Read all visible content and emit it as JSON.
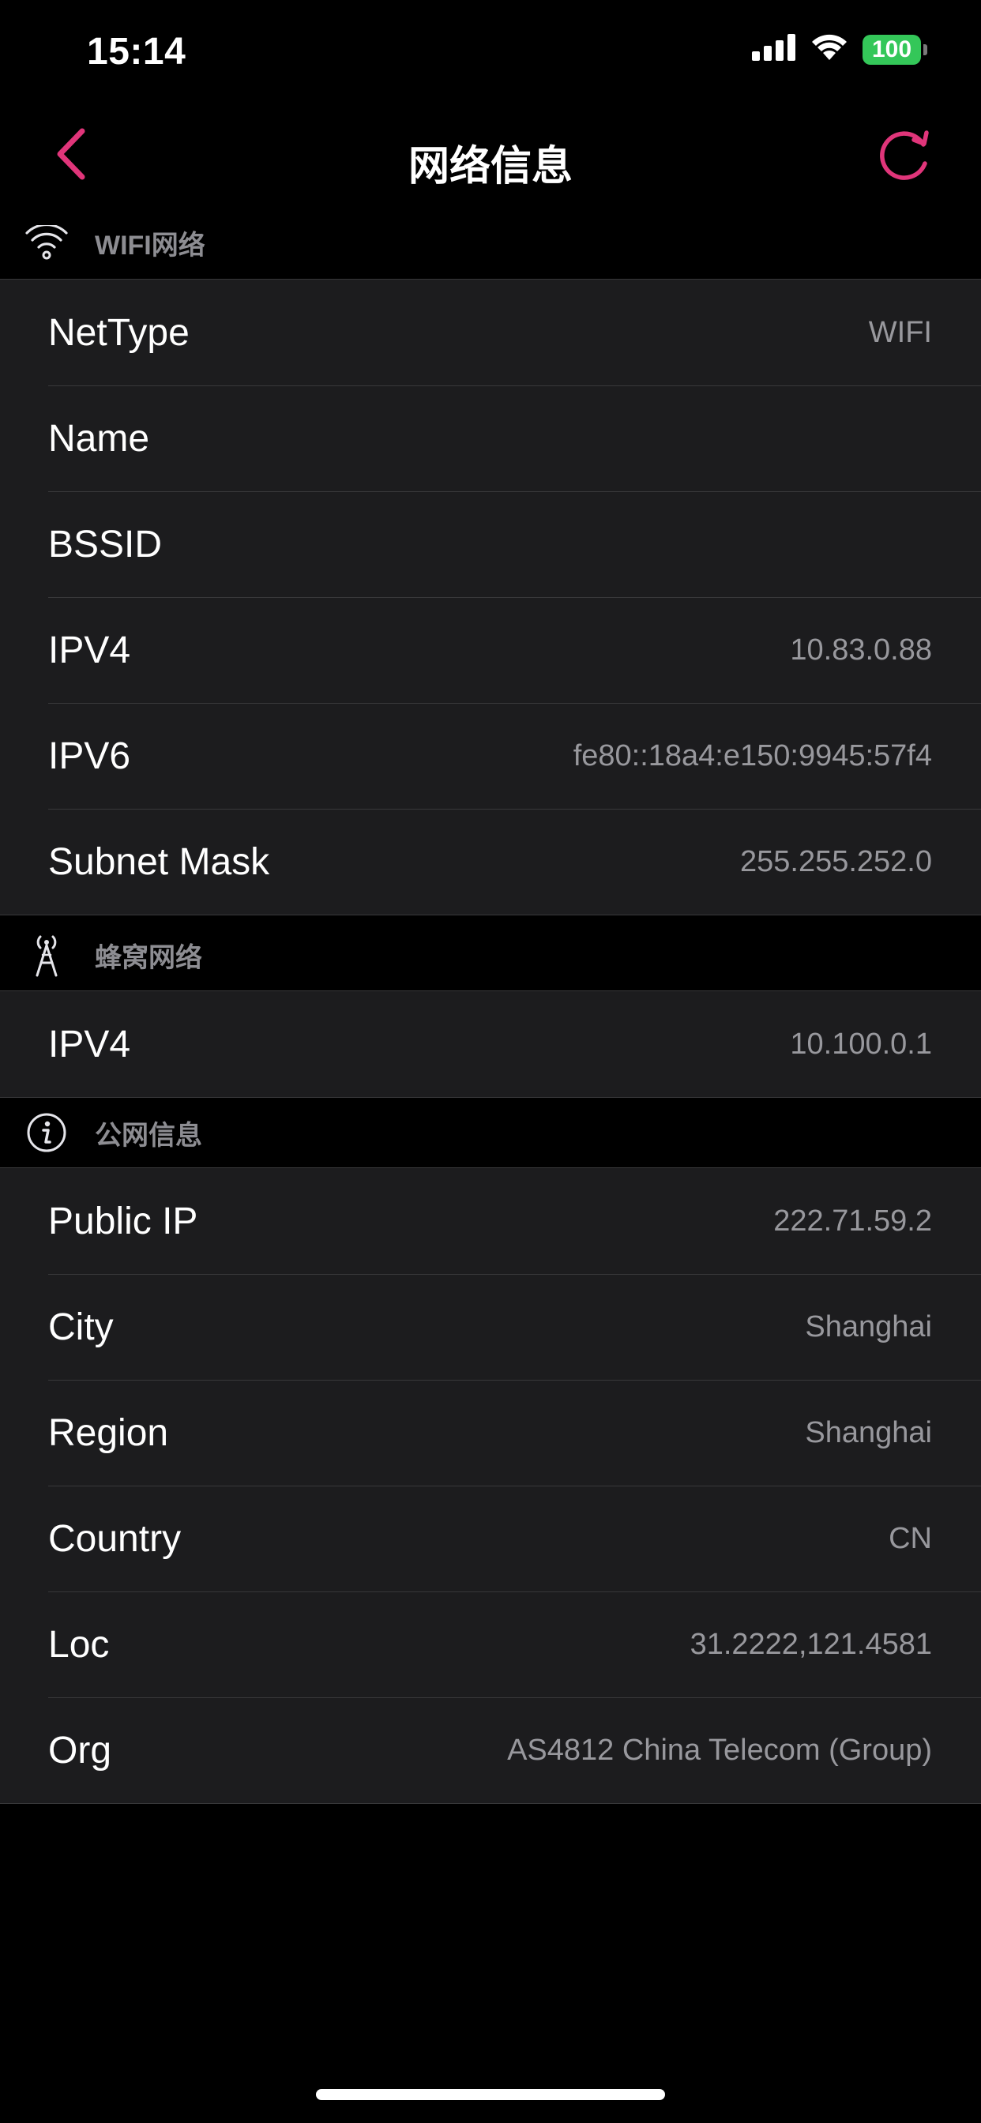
{
  "status_bar": {
    "time": "15:14",
    "battery": "100",
    "icons": [
      "signal-bars-icon",
      "wifi-icon",
      "battery-icon"
    ]
  },
  "nav": {
    "title": "网络信息",
    "back_icon": "chevron-left-icon",
    "refresh_icon": "refresh-icon",
    "accent_color": "#e0357a"
  },
  "sections": {
    "wifi": {
      "title": "WIFI网络",
      "icon": "wifi-icon",
      "rows": [
        {
          "label": "NetType",
          "value": "WIFI"
        },
        {
          "label": "Name",
          "value": ""
        },
        {
          "label": "BSSID",
          "value": ""
        },
        {
          "label": "IPV4",
          "value": "10.83.0.88"
        },
        {
          "label": "IPV6",
          "value": "fe80::18a4:e150:9945:57f4"
        },
        {
          "label": "Subnet Mask",
          "value": "255.255.252.0"
        }
      ]
    },
    "cellular": {
      "title": "蜂窝网络",
      "icon": "cell-tower-icon",
      "rows": [
        {
          "label": "IPV4",
          "value": "10.100.0.1"
        }
      ]
    },
    "public": {
      "title": "公网信息",
      "icon": "info-circle-icon",
      "rows": [
        {
          "label": "Public IP",
          "value": "222.71.59.2"
        },
        {
          "label": "City",
          "value": "Shanghai"
        },
        {
          "label": "Region",
          "value": "Shanghai"
        },
        {
          "label": "Country",
          "value": "CN"
        },
        {
          "label": "Loc",
          "value": "31.2222,121.4581"
        },
        {
          "label": "Org",
          "value": "AS4812 China Telecom (Group)"
        }
      ]
    }
  }
}
